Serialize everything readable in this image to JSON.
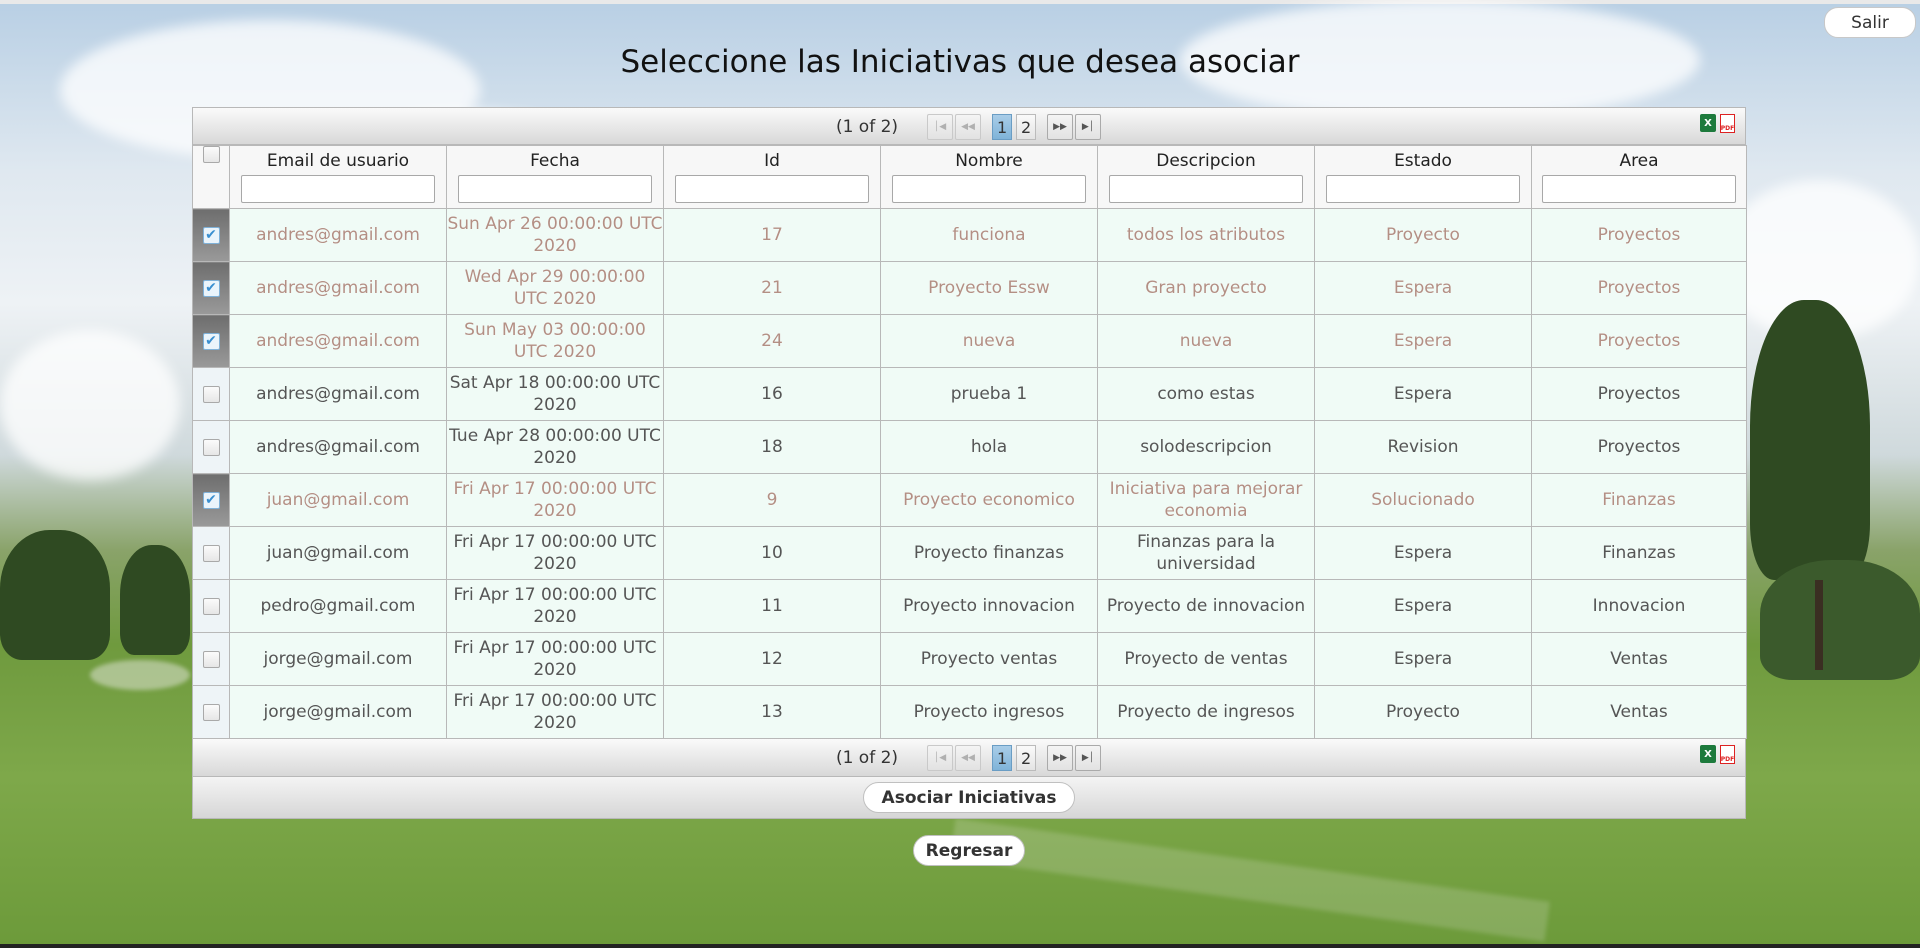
{
  "header": {
    "logout_label": "Salir",
    "title": "Seleccione las Iniciativas que desea asociar"
  },
  "paginator": {
    "current_page_report": "(1 of 2)",
    "pages": [
      "1",
      "2"
    ],
    "active_page": "1",
    "first_icon": "first-page-icon",
    "prev_icon": "prev-page-icon",
    "next_icon": "next-page-icon",
    "last_icon": "last-page-icon",
    "export_icons": [
      "excel-export-icon",
      "pdf-export-icon"
    ]
  },
  "table": {
    "columns": [
      "Email de usuario",
      "Fecha",
      "Id",
      "Nombre",
      "Descripcion",
      "Estado",
      "Area"
    ],
    "rows": [
      {
        "selected": true,
        "email": "andres@gmail.com",
        "fecha": "Sun Apr 26 00:00:00 UTC 2020",
        "id": "17",
        "nombre": "funciona",
        "descripcion": "todos los atributos",
        "estado": "Proyecto",
        "area": "Proyectos"
      },
      {
        "selected": true,
        "email": "andres@gmail.com",
        "fecha": "Wed Apr 29 00:00:00 UTC 2020",
        "id": "21",
        "nombre": "Proyecto Essw",
        "descripcion": "Gran proyecto",
        "estado": "Espera",
        "area": "Proyectos"
      },
      {
        "selected": true,
        "email": "andres@gmail.com",
        "fecha": "Sun May 03 00:00:00 UTC 2020",
        "id": "24",
        "nombre": "nueva",
        "descripcion": "nueva",
        "estado": "Espera",
        "area": "Proyectos"
      },
      {
        "selected": false,
        "email": "andres@gmail.com",
        "fecha": "Sat Apr 18 00:00:00 UTC 2020",
        "id": "16",
        "nombre": "prueba 1",
        "descripcion": "como estas",
        "estado": "Espera",
        "area": "Proyectos"
      },
      {
        "selected": false,
        "email": "andres@gmail.com",
        "fecha": "Tue Apr 28 00:00:00 UTC 2020",
        "id": "18",
        "nombre": "hola",
        "descripcion": "solodescripcion",
        "estado": "Revision",
        "area": "Proyectos"
      },
      {
        "selected": true,
        "email": "juan@gmail.com",
        "fecha": "Fri Apr 17 00:00:00 UTC 2020",
        "id": "9",
        "nombre": "Proyecto economico",
        "descripcion": "Iniciativa para mejorar economia",
        "estado": "Solucionado",
        "area": "Finanzas"
      },
      {
        "selected": false,
        "email": "juan@gmail.com",
        "fecha": "Fri Apr 17 00:00:00 UTC 2020",
        "id": "10",
        "nombre": "Proyecto finanzas",
        "descripcion": "Finanzas para la universidad",
        "estado": "Espera",
        "area": "Finanzas"
      },
      {
        "selected": false,
        "email": "pedro@gmail.com",
        "fecha": "Fri Apr 17 00:00:00 UTC 2020",
        "id": "11",
        "nombre": "Proyecto innovacion",
        "descripcion": "Proyecto de innovacion",
        "estado": "Espera",
        "area": "Innovacion"
      },
      {
        "selected": false,
        "email": "jorge@gmail.com",
        "fecha": "Fri Apr 17 00:00:00 UTC 2020",
        "id": "12",
        "nombre": "Proyecto ventas",
        "descripcion": "Proyecto de ventas",
        "estado": "Espera",
        "area": "Ventas"
      },
      {
        "selected": false,
        "email": "jorge@gmail.com",
        "fecha": "Fri Apr 17 00:00:00 UTC 2020",
        "id": "13",
        "nombre": "Proyecto ingresos",
        "descripcion": "Proyecto de ingresos",
        "estado": "Proyecto",
        "area": "Ventas"
      }
    ]
  },
  "actions": {
    "associate_label": "Asociar Iniciativas",
    "back_label": "Regresar"
  },
  "colors": {
    "row_background": "#f0fbf6",
    "selected_row_text": "#b38f84",
    "active_page": "#7fb3d8"
  }
}
